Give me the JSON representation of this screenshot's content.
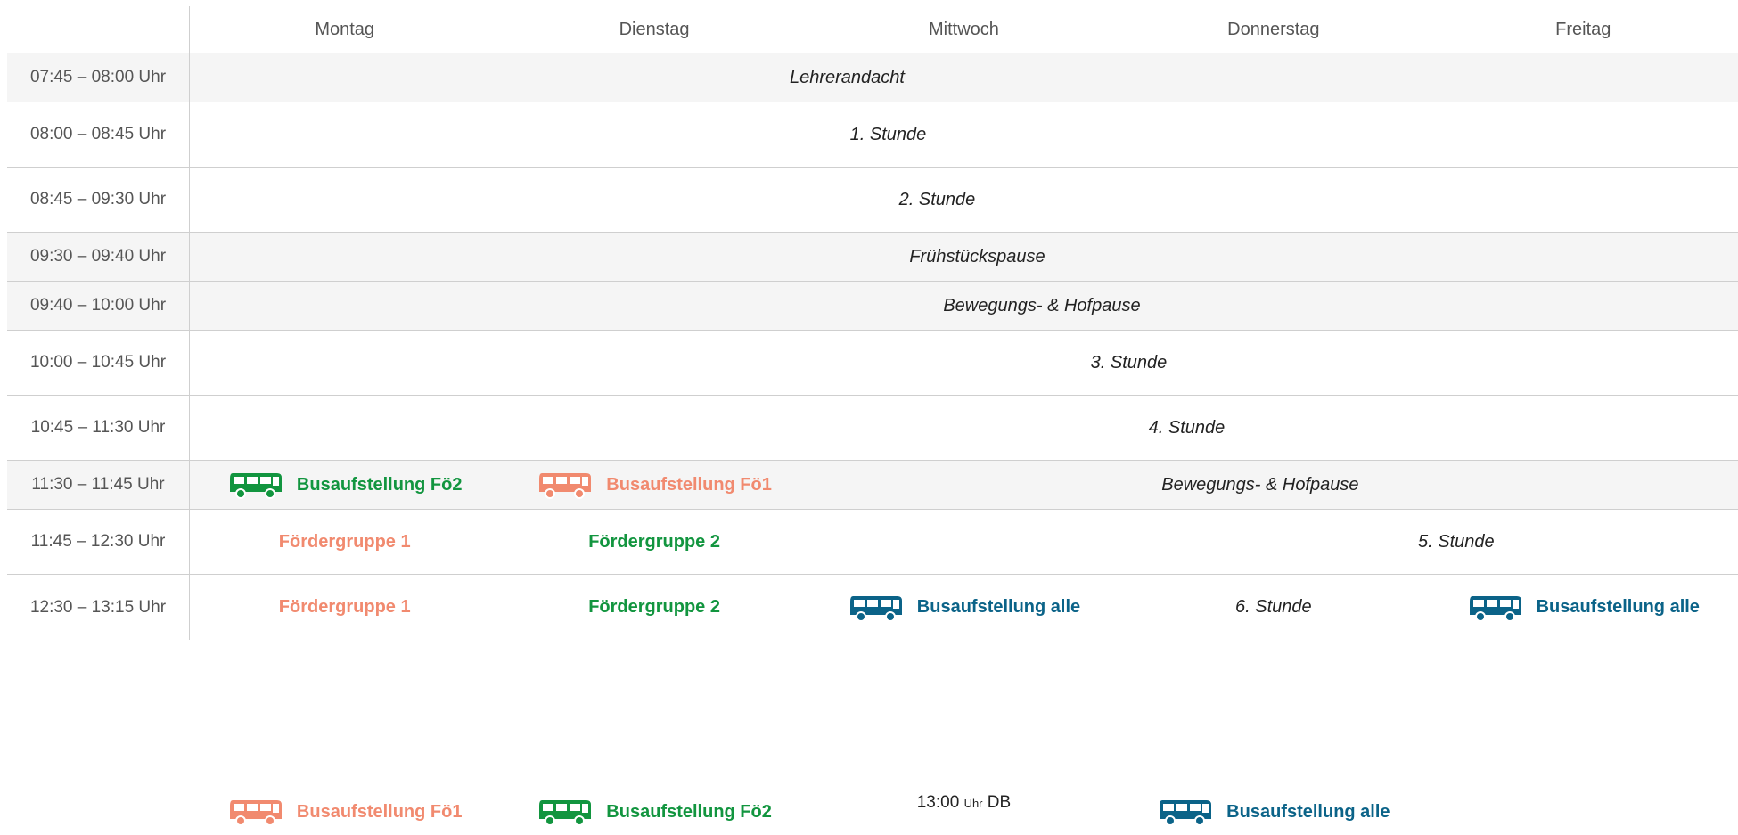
{
  "days": [
    "Montag",
    "Dienstag",
    "Mittwoch",
    "Donnerstag",
    "Freitag"
  ],
  "times": [
    "07:45 – 08:00 Uhr",
    "08:00 – 08:45 Uhr",
    "08:45 – 09:30 Uhr",
    "09:30 – 09:40 Uhr",
    "09:40 – 10:00 Uhr",
    "10:00 – 10:45 Uhr",
    "10:45 – 11:30 Uhr",
    "11:30 – 11:45 Uhr",
    "11:45 – 12:30 Uhr",
    "12:30 – 13:15 Uhr"
  ],
  "periods": {
    "lehrerandacht": "Lehrerandacht",
    "stunde1": "1. Stunde",
    "stunde2": "2. Stunde",
    "fruehstueck": "Frühstückspause",
    "hofpause1": "Bewegungs- & Hofpause",
    "stunde3": "3. Stunde",
    "stunde4": "4. Stunde",
    "hofpause2": "Bewegungs- & Hofpause",
    "stunde5": "5. Stunde",
    "stunde6": "6. Stunde"
  },
  "labels": {
    "bus_foe1": "Busaufstellung Fö1",
    "bus_foe2": "Busaufstellung Fö2",
    "bus_alle": "Busaufstellung alle",
    "foerdergruppe1": "Fördergruppe 1",
    "foerdergruppe2": "Fördergruppe 2",
    "db_time": "13:00",
    "db_unit": "Uhr",
    "db_label": "DB"
  },
  "colors": {
    "orange": "#f18a6f",
    "green": "#12953f",
    "blue": "#0b6388"
  },
  "icons": {
    "bus": "bus-icon"
  }
}
